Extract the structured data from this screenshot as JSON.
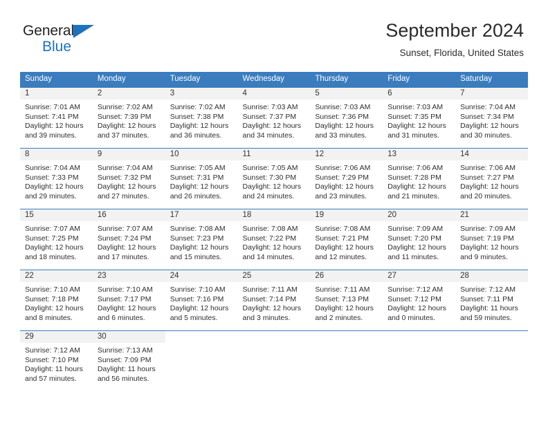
{
  "brand": {
    "name_dark": "General",
    "name_blue": "Blue",
    "accent_color": "#1c72bd"
  },
  "header": {
    "title": "September 2024",
    "subtitle": "Sunset, Florida, United States"
  },
  "theme": {
    "header_row_bg": "#3a7cbe",
    "header_row_text": "#ffffff",
    "daynum_band_bg": "#f2f2f2",
    "grid_line": "#3a7cbe",
    "body_text": "#2e2e2e"
  },
  "weekday_headers": [
    "Sunday",
    "Monday",
    "Tuesday",
    "Wednesday",
    "Thursday",
    "Friday",
    "Saturday"
  ],
  "labels": {
    "sunrise_prefix": "Sunrise:",
    "sunset_prefix": "Sunset:",
    "daylight_prefix": "Daylight:"
  },
  "weeks": [
    [
      {
        "day": "1",
        "sunrise": "Sunrise: 7:01 AM",
        "sunset": "Sunset: 7:41 PM",
        "daylight_1": "Daylight: 12 hours",
        "daylight_2": "and 39 minutes."
      },
      {
        "day": "2",
        "sunrise": "Sunrise: 7:02 AM",
        "sunset": "Sunset: 7:39 PM",
        "daylight_1": "Daylight: 12 hours",
        "daylight_2": "and 37 minutes."
      },
      {
        "day": "3",
        "sunrise": "Sunrise: 7:02 AM",
        "sunset": "Sunset: 7:38 PM",
        "daylight_1": "Daylight: 12 hours",
        "daylight_2": "and 36 minutes."
      },
      {
        "day": "4",
        "sunrise": "Sunrise: 7:03 AM",
        "sunset": "Sunset: 7:37 PM",
        "daylight_1": "Daylight: 12 hours",
        "daylight_2": "and 34 minutes."
      },
      {
        "day": "5",
        "sunrise": "Sunrise: 7:03 AM",
        "sunset": "Sunset: 7:36 PM",
        "daylight_1": "Daylight: 12 hours",
        "daylight_2": "and 33 minutes."
      },
      {
        "day": "6",
        "sunrise": "Sunrise: 7:03 AM",
        "sunset": "Sunset: 7:35 PM",
        "daylight_1": "Daylight: 12 hours",
        "daylight_2": "and 31 minutes."
      },
      {
        "day": "7",
        "sunrise": "Sunrise: 7:04 AM",
        "sunset": "Sunset: 7:34 PM",
        "daylight_1": "Daylight: 12 hours",
        "daylight_2": "and 30 minutes."
      }
    ],
    [
      {
        "day": "8",
        "sunrise": "Sunrise: 7:04 AM",
        "sunset": "Sunset: 7:33 PM",
        "daylight_1": "Daylight: 12 hours",
        "daylight_2": "and 29 minutes."
      },
      {
        "day": "9",
        "sunrise": "Sunrise: 7:04 AM",
        "sunset": "Sunset: 7:32 PM",
        "daylight_1": "Daylight: 12 hours",
        "daylight_2": "and 27 minutes."
      },
      {
        "day": "10",
        "sunrise": "Sunrise: 7:05 AM",
        "sunset": "Sunset: 7:31 PM",
        "daylight_1": "Daylight: 12 hours",
        "daylight_2": "and 26 minutes."
      },
      {
        "day": "11",
        "sunrise": "Sunrise: 7:05 AM",
        "sunset": "Sunset: 7:30 PM",
        "daylight_1": "Daylight: 12 hours",
        "daylight_2": "and 24 minutes."
      },
      {
        "day": "12",
        "sunrise": "Sunrise: 7:06 AM",
        "sunset": "Sunset: 7:29 PM",
        "daylight_1": "Daylight: 12 hours",
        "daylight_2": "and 23 minutes."
      },
      {
        "day": "13",
        "sunrise": "Sunrise: 7:06 AM",
        "sunset": "Sunset: 7:28 PM",
        "daylight_1": "Daylight: 12 hours",
        "daylight_2": "and 21 minutes."
      },
      {
        "day": "14",
        "sunrise": "Sunrise: 7:06 AM",
        "sunset": "Sunset: 7:27 PM",
        "daylight_1": "Daylight: 12 hours",
        "daylight_2": "and 20 minutes."
      }
    ],
    [
      {
        "day": "15",
        "sunrise": "Sunrise: 7:07 AM",
        "sunset": "Sunset: 7:25 PM",
        "daylight_1": "Daylight: 12 hours",
        "daylight_2": "and 18 minutes."
      },
      {
        "day": "16",
        "sunrise": "Sunrise: 7:07 AM",
        "sunset": "Sunset: 7:24 PM",
        "daylight_1": "Daylight: 12 hours",
        "daylight_2": "and 17 minutes."
      },
      {
        "day": "17",
        "sunrise": "Sunrise: 7:08 AM",
        "sunset": "Sunset: 7:23 PM",
        "daylight_1": "Daylight: 12 hours",
        "daylight_2": "and 15 minutes."
      },
      {
        "day": "18",
        "sunrise": "Sunrise: 7:08 AM",
        "sunset": "Sunset: 7:22 PM",
        "daylight_1": "Daylight: 12 hours",
        "daylight_2": "and 14 minutes."
      },
      {
        "day": "19",
        "sunrise": "Sunrise: 7:08 AM",
        "sunset": "Sunset: 7:21 PM",
        "daylight_1": "Daylight: 12 hours",
        "daylight_2": "and 12 minutes."
      },
      {
        "day": "20",
        "sunrise": "Sunrise: 7:09 AM",
        "sunset": "Sunset: 7:20 PM",
        "daylight_1": "Daylight: 12 hours",
        "daylight_2": "and 11 minutes."
      },
      {
        "day": "21",
        "sunrise": "Sunrise: 7:09 AM",
        "sunset": "Sunset: 7:19 PM",
        "daylight_1": "Daylight: 12 hours",
        "daylight_2": "and 9 minutes."
      }
    ],
    [
      {
        "day": "22",
        "sunrise": "Sunrise: 7:10 AM",
        "sunset": "Sunset: 7:18 PM",
        "daylight_1": "Daylight: 12 hours",
        "daylight_2": "and 8 minutes."
      },
      {
        "day": "23",
        "sunrise": "Sunrise: 7:10 AM",
        "sunset": "Sunset: 7:17 PM",
        "daylight_1": "Daylight: 12 hours",
        "daylight_2": "and 6 minutes."
      },
      {
        "day": "24",
        "sunrise": "Sunrise: 7:10 AM",
        "sunset": "Sunset: 7:16 PM",
        "daylight_1": "Daylight: 12 hours",
        "daylight_2": "and 5 minutes."
      },
      {
        "day": "25",
        "sunrise": "Sunrise: 7:11 AM",
        "sunset": "Sunset: 7:14 PM",
        "daylight_1": "Daylight: 12 hours",
        "daylight_2": "and 3 minutes."
      },
      {
        "day": "26",
        "sunrise": "Sunrise: 7:11 AM",
        "sunset": "Sunset: 7:13 PM",
        "daylight_1": "Daylight: 12 hours",
        "daylight_2": "and 2 minutes."
      },
      {
        "day": "27",
        "sunrise": "Sunrise: 7:12 AM",
        "sunset": "Sunset: 7:12 PM",
        "daylight_1": "Daylight: 12 hours",
        "daylight_2": "and 0 minutes."
      },
      {
        "day": "28",
        "sunrise": "Sunrise: 7:12 AM",
        "sunset": "Sunset: 7:11 PM",
        "daylight_1": "Daylight: 11 hours",
        "daylight_2": "and 59 minutes."
      }
    ],
    [
      {
        "day": "29",
        "sunrise": "Sunrise: 7:12 AM",
        "sunset": "Sunset: 7:10 PM",
        "daylight_1": "Daylight: 11 hours",
        "daylight_2": "and 57 minutes."
      },
      {
        "day": "30",
        "sunrise": "Sunrise: 7:13 AM",
        "sunset": "Sunset: 7:09 PM",
        "daylight_1": "Daylight: 11 hours",
        "daylight_2": "and 56 minutes."
      },
      {
        "day": "",
        "sunrise": "",
        "sunset": "",
        "daylight_1": "",
        "daylight_2": ""
      },
      {
        "day": "",
        "sunrise": "",
        "sunset": "",
        "daylight_1": "",
        "daylight_2": ""
      },
      {
        "day": "",
        "sunrise": "",
        "sunset": "",
        "daylight_1": "",
        "daylight_2": ""
      },
      {
        "day": "",
        "sunrise": "",
        "sunset": "",
        "daylight_1": "",
        "daylight_2": ""
      },
      {
        "day": "",
        "sunrise": "",
        "sunset": "",
        "daylight_1": "",
        "daylight_2": ""
      }
    ]
  ]
}
